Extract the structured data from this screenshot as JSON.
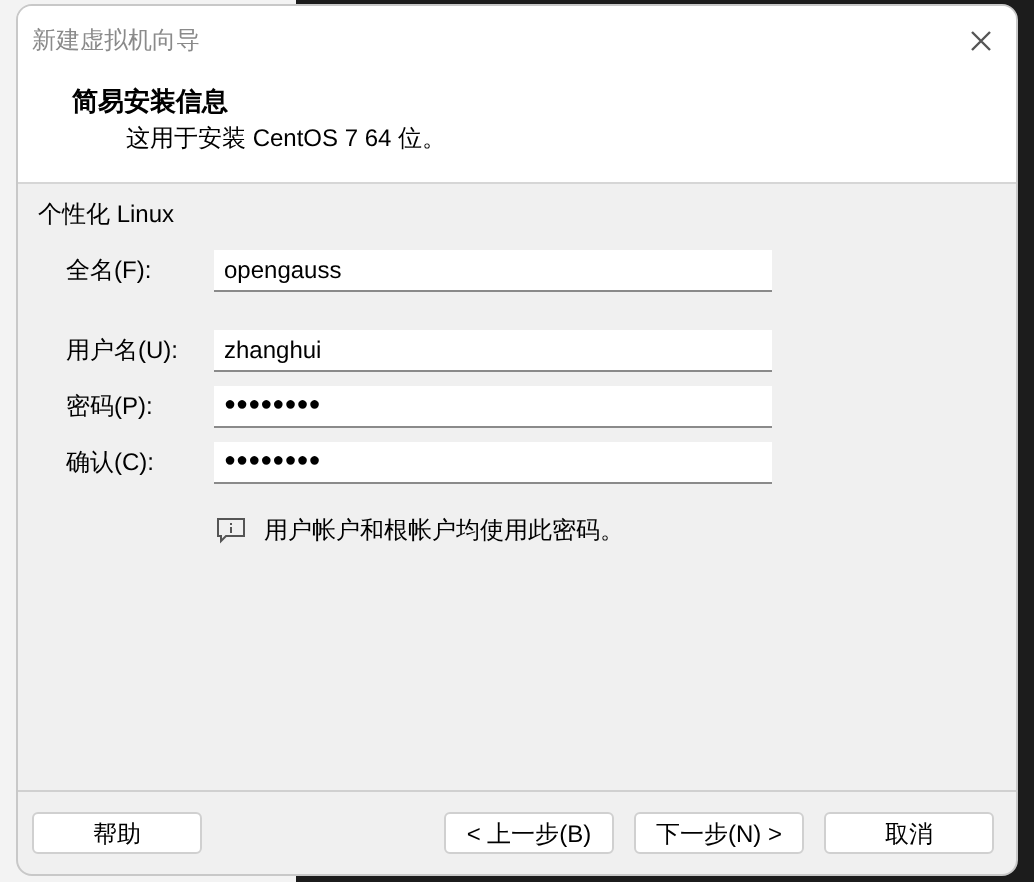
{
  "window": {
    "title": "新建虚拟机向导"
  },
  "header": {
    "title": "简易安装信息",
    "subtitle": "这用于安装 CentOS 7 64 位。"
  },
  "section": {
    "title": "个性化 Linux"
  },
  "fields": [
    {
      "label": "全名(F):",
      "value": "opengauss",
      "kind": "text"
    },
    {
      "label": "用户名(U):",
      "value": "zhanghui",
      "kind": "text"
    },
    {
      "label": "密码(P):",
      "value": "●●●●●●●●",
      "kind": "password"
    },
    {
      "label": "确认(C):",
      "value": "●●●●●●●●",
      "kind": "password"
    }
  ],
  "hint": "用户帐户和根帐户均使用此密码。",
  "buttons": [
    {
      "label": "帮助",
      "kind": "help"
    },
    {
      "label": "< 上一步(B)",
      "kind": "nav"
    },
    {
      "label": "下一步(N) >",
      "kind": "nav"
    },
    {
      "label": "取消",
      "kind": "nav"
    }
  ]
}
